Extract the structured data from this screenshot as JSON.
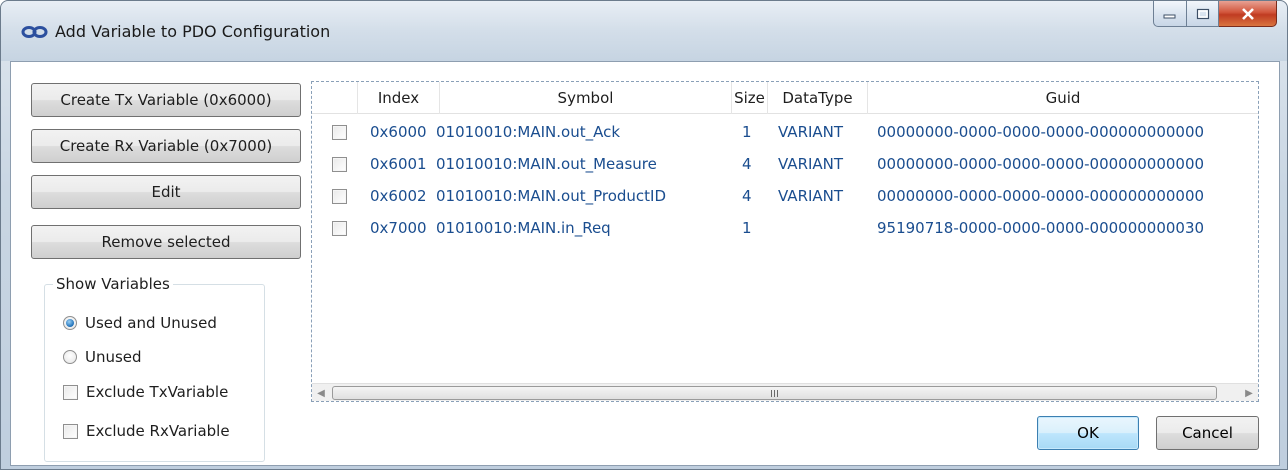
{
  "window": {
    "title": "Add Variable to PDO Configuration",
    "icon": "link-icon",
    "close_color": "#c8452b"
  },
  "actions": {
    "create_tx": "Create Tx Variable (0x6000)",
    "create_rx": "Create Rx Variable (0x7000)",
    "edit": "Edit",
    "remove": "Remove selected"
  },
  "show_variables": {
    "title": "Show Variables",
    "options": [
      {
        "label": "Used and Unused",
        "type": "radio",
        "checked": true
      },
      {
        "label": "Unused",
        "type": "radio",
        "checked": false
      },
      {
        "label": "Exclude TxVariable",
        "type": "checkbox",
        "checked": false
      },
      {
        "label": "Exclude RxVariable",
        "type": "checkbox",
        "checked": false
      }
    ]
  },
  "table": {
    "columns": [
      "",
      "Index",
      "Symbol",
      "Size",
      "DataType",
      "Guid"
    ],
    "rows": [
      {
        "index": "0x6000",
        "symbol": "01010010:MAIN.out_Ack",
        "size": "1",
        "datatype": "VARIANT",
        "guid": "00000000-0000-0000-0000-000000000000",
        "checked": false
      },
      {
        "index": "0x6001",
        "symbol": "01010010:MAIN.out_Measure",
        "size": "4",
        "datatype": "VARIANT",
        "guid": "00000000-0000-0000-0000-000000000000",
        "checked": false
      },
      {
        "index": "0x6002",
        "symbol": "01010010:MAIN.out_ProductID",
        "size": "4",
        "datatype": "VARIANT",
        "guid": "00000000-0000-0000-0000-000000000000",
        "checked": false
      },
      {
        "index": "0x7000",
        "symbol": "01010010:MAIN.in_Req",
        "size": "1",
        "datatype": "",
        "guid": "95190718-0000-0000-0000-000000000030",
        "checked": false
      }
    ],
    "text_color": "#1a4d8f"
  },
  "footer": {
    "ok": "OK",
    "cancel": "Cancel"
  }
}
